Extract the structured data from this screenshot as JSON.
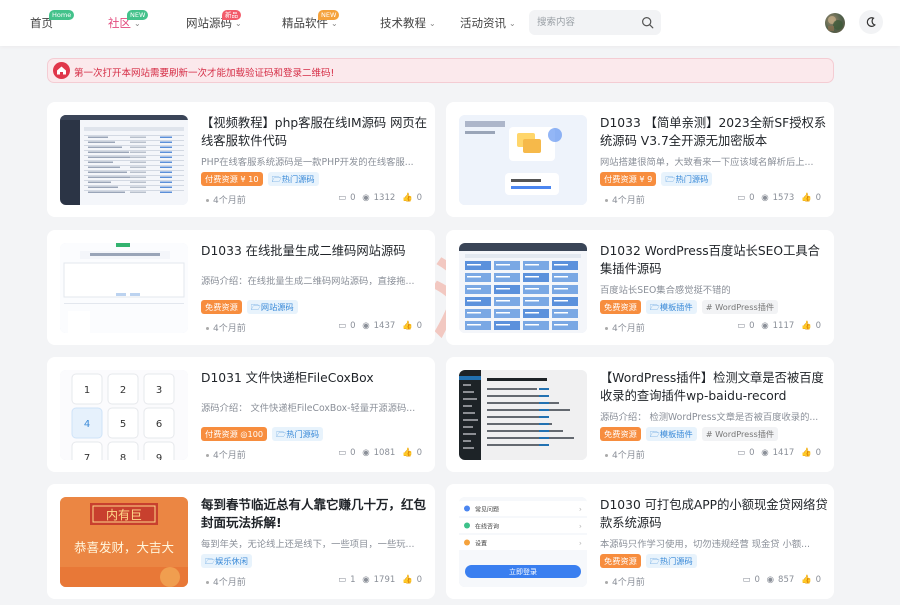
{
  "nav": {
    "items": [
      {
        "label": "首页",
        "badge": "Home",
        "badge_color": "#43c28b",
        "active": false,
        "has_chevron": false
      },
      {
        "label": "社区",
        "badge": "NEW",
        "badge_color": "#43c28b",
        "active": true,
        "has_chevron": true
      },
      {
        "label": "网站源码",
        "badge": "新品",
        "badge_color": "#f25c6b",
        "active": false,
        "has_chevron": true
      },
      {
        "label": "精品软件",
        "badge": "NEW",
        "badge_color": "#f5a23c",
        "active": false,
        "has_chevron": true
      },
      {
        "label": "技术教程",
        "badge": "",
        "badge_color": "",
        "active": false,
        "has_chevron": true
      },
      {
        "label": "活动资讯",
        "badge": "",
        "badge_color": "",
        "active": false,
        "has_chevron": true
      }
    ],
    "active_color": "#e24a7d",
    "search_placeholder": "搜索内容"
  },
  "notice": {
    "text": "第一次打开本网站需要刷新一次才能加载验证码和登录二维码!"
  },
  "watermark_text": "一滴摸鱼",
  "posts": [
    {
      "title": "【视频教程】php客服在线IM源码 网页在线客服软件代码",
      "desc": "PHP在线客服系统源码是一款PHP开发的在线客服...",
      "tags": [
        {
          "label": "付费资源 ¥ 10",
          "type": "pay"
        },
        {
          "label": "热门源码",
          "type": "cat"
        }
      ],
      "date": "4个月前",
      "comments": "0",
      "views": "1312",
      "likes": "0",
      "thumb": "admin"
    },
    {
      "title": "D1033 【简单亲测】2023全新SF授权系统源码 V3.7全开源无加密版本",
      "desc": "网站搭建很简单，大致看来一下应该域名解析后上...",
      "tags": [
        {
          "label": "付费资源 ¥ 9",
          "type": "pay"
        },
        {
          "label": "热门源码",
          "type": "cat"
        }
      ],
      "date": "4个月前",
      "comments": "0",
      "views": "1573",
      "likes": "0",
      "thumb": "sf"
    },
    {
      "title": "D1033 在线批量生成二维码网站源码",
      "desc": "源码介绍：在线批量生成二维码网站源码，直接拖...",
      "tags": [
        {
          "label": "免费资源",
          "type": "free"
        },
        {
          "label": "网站源码",
          "type": "cat"
        }
      ],
      "date": "4个月前",
      "comments": "0",
      "views": "1437",
      "likes": "0",
      "thumb": "qr"
    },
    {
      "title": "D1032 WordPress百度站长SEO工具合集插件源码",
      "desc": "百度站长SEO集合感觉挺不错的",
      "tags": [
        {
          "label": "免费资源",
          "type": "free"
        },
        {
          "label": "模板插件",
          "type": "cat"
        },
        {
          "label": "# WordPress插件",
          "type": "hash"
        }
      ],
      "date": "4个月前",
      "comments": "0",
      "views": "1117",
      "likes": "0",
      "thumb": "grid"
    },
    {
      "title": "D1031 文件快递柜FileCoxBox",
      "desc": "源码介绍：  文件快递柜FileCoxBox-轻量开源源码...",
      "tags": [
        {
          "label": "付费资源 ◎100",
          "type": "pay"
        },
        {
          "label": "热门源码",
          "type": "cat"
        }
      ],
      "date": "4个月前",
      "comments": "0",
      "views": "1081",
      "likes": "0",
      "thumb": "keypad"
    },
    {
      "title": "【WordPress插件】检测文章是否被百度收录的查询插件wp-baidu-record",
      "desc": "源码介绍：  检测WordPress文章是否被百度收录的...",
      "tags": [
        {
          "label": "免费资源",
          "type": "free"
        },
        {
          "label": "模板插件",
          "type": "cat"
        },
        {
          "label": "# WordPress插件",
          "type": "hash"
        }
      ],
      "date": "4个月前",
      "comments": "0",
      "views": "1417",
      "likes": "0",
      "thumb": "wp"
    },
    {
      "title": "每到春节临近总有人靠它赚几十万，红包封面玩法拆解!",
      "desc": "每到年关，无论线上还是线下，一些项目，一些玩...",
      "tags": [
        {
          "label": "娱乐休闲",
          "type": "cat"
        }
      ],
      "date": "4个月前",
      "comments": "1",
      "views": "1791",
      "likes": "0",
      "thumb": "red",
      "bold": true
    },
    {
      "title": "D1030 可打包成APP的小额现金贷网络贷款系统源码",
      "desc": "本源码只作学习使用，切勿违规经营 现金贷 小额...",
      "tags": [
        {
          "label": "免费资源",
          "type": "free"
        },
        {
          "label": "热门源码",
          "type": "cat"
        }
      ],
      "date": "4个月前",
      "comments": "0",
      "views": "857",
      "likes": "0",
      "thumb": "loan"
    }
  ],
  "thumb_text": {
    "keypad": [
      "1",
      "2",
      "3",
      "4",
      "5",
      "6",
      "7",
      "8",
      "9"
    ],
    "red_banner": "内有巨",
    "red_caption": "恭喜发财，大吉大",
    "loan_button": "立即登录",
    "loan_rows": [
      "常见问题",
      "在线咨询",
      "设置"
    ]
  }
}
